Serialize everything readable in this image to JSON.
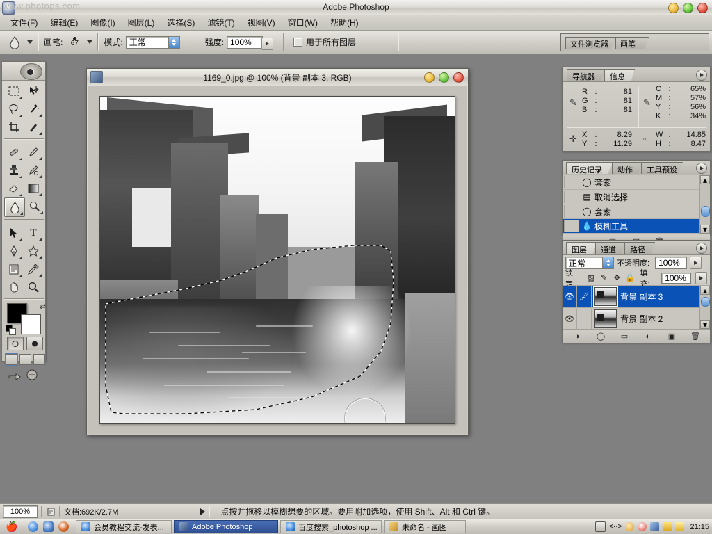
{
  "window": {
    "title": "Adobe Photoshop",
    "watermark": "www.photops.com",
    "buttons": {
      "minimize": "minimize",
      "maximize": "maximize",
      "close": "close"
    }
  },
  "menu": {
    "items": [
      {
        "label": "文件(F)"
      },
      {
        "label": "编辑(E)"
      },
      {
        "label": "图像(I)"
      },
      {
        "label": "图层(L)"
      },
      {
        "label": "选择(S)"
      },
      {
        "label": "滤镜(T)"
      },
      {
        "label": "视图(V)"
      },
      {
        "label": "窗口(W)"
      },
      {
        "label": "帮助(H)"
      }
    ]
  },
  "options_bar": {
    "tool_icon": "blur-droplet-icon",
    "brush_label": "画笔:",
    "brush_size": "67",
    "mode_label": "模式:",
    "mode_value": "正常",
    "strength_label": "强度:",
    "strength_value": "100%",
    "all_layers_label": "用于所有图层",
    "all_layers_checked": false,
    "palette_well_icon": "palette-well-icon"
  },
  "palette_well": {
    "tabs": [
      {
        "label": "文件浏览器"
      },
      {
        "label": "画笔"
      }
    ]
  },
  "toolbox": {
    "tools": [
      {
        "name": "marquee-tool",
        "glyph": "▭"
      },
      {
        "name": "move-tool",
        "glyph": "✥"
      },
      {
        "name": "lasso-tool",
        "glyph": "◯"
      },
      {
        "name": "magic-wand-tool",
        "glyph": "✳"
      },
      {
        "name": "crop-tool",
        "glyph": "⌗"
      },
      {
        "name": "slice-tool",
        "glyph": "✎"
      },
      {
        "name": "healing-brush-tool",
        "glyph": "✐"
      },
      {
        "name": "brush-tool",
        "glyph": "🖌"
      },
      {
        "name": "clone-stamp-tool",
        "glyph": "⎙"
      },
      {
        "name": "history-brush-tool",
        "glyph": "✑"
      },
      {
        "name": "eraser-tool",
        "glyph": "▱"
      },
      {
        "name": "gradient-tool",
        "glyph": "▤"
      },
      {
        "name": "blur-tool",
        "glyph": "💧",
        "selected": true
      },
      {
        "name": "dodge-tool",
        "glyph": "◐"
      },
      {
        "name": "path-selection-tool",
        "glyph": "➤"
      },
      {
        "name": "type-tool",
        "glyph": "T"
      },
      {
        "name": "pen-tool",
        "glyph": "✒"
      },
      {
        "name": "custom-shape-tool",
        "glyph": "✦"
      },
      {
        "name": "notes-tool",
        "glyph": "▤"
      },
      {
        "name": "eyedropper-tool",
        "glyph": "✎"
      },
      {
        "name": "hand-tool",
        "glyph": "✋"
      },
      {
        "name": "zoom-tool",
        "glyph": "🔍"
      }
    ],
    "foreground_color": "#000000",
    "background_color": "#ffffff",
    "quickmask": [
      {
        "name": "standard-mode",
        "active": true
      },
      {
        "name": "quick-mask-mode",
        "active": false
      }
    ],
    "screen_modes": [
      {
        "name": "standard-screen-mode",
        "active": true
      },
      {
        "name": "full-screen-menubar-mode",
        "active": false
      },
      {
        "name": "full-screen-mode",
        "active": false
      }
    ],
    "jump_to": "jump-to-imageready-icon"
  },
  "document": {
    "title": "1169_0.jpg @ 100% (背景 副本 3, RGB)",
    "filename": "1169_0.jpg",
    "zoom": "100%",
    "layer": "背景 副本 3",
    "color_mode": "RGB"
  },
  "info_palette": {
    "tabs": [
      {
        "label": "导航器",
        "active": false
      },
      {
        "label": "信息",
        "active": true
      }
    ],
    "rgb": [
      {
        "key": "R",
        "value": "81"
      },
      {
        "key": "G",
        "value": "81"
      },
      {
        "key": "B",
        "value": "81"
      }
    ],
    "cmyk": [
      {
        "key": "C",
        "value": "65%"
      },
      {
        "key": "M",
        "value": "57%"
      },
      {
        "key": "Y",
        "value": "56%"
      },
      {
        "key": "K",
        "value": "34%"
      }
    ],
    "position": [
      {
        "key": "X",
        "value": "8.29"
      },
      {
        "key": "Y",
        "value": "11.29"
      }
    ],
    "size": [
      {
        "key": "W",
        "value": "14.85"
      },
      {
        "key": "H",
        "value": "8.47"
      }
    ]
  },
  "history_palette": {
    "tabs": [
      {
        "label": "历史记录",
        "active": true
      },
      {
        "label": "动作",
        "active": false
      },
      {
        "label": "工具预设",
        "active": false
      }
    ],
    "items": [
      {
        "label": "套索",
        "icon": "lasso-icon",
        "selected": false
      },
      {
        "label": "取消选择",
        "icon": "deselect-icon",
        "selected": false
      },
      {
        "label": "套索",
        "icon": "lasso-icon",
        "selected": false
      },
      {
        "label": "模糊工具",
        "icon": "blur-droplet-icon",
        "selected": true
      }
    ],
    "buttons": [
      {
        "name": "create-document-from-state-button",
        "glyph": "▣"
      },
      {
        "name": "create-new-snapshot-button",
        "glyph": "▤"
      },
      {
        "name": "delete-state-button",
        "glyph": "🗑"
      }
    ]
  },
  "layers_palette": {
    "tabs": [
      {
        "label": "图层",
        "active": true
      },
      {
        "label": "通道",
        "active": false
      },
      {
        "label": "路径",
        "active": false
      }
    ],
    "blend_mode": "正常",
    "opacity_label": "不透明度:",
    "opacity_value": "100%",
    "lock_label": "锁定:",
    "lock_icons": [
      {
        "name": "lock-transparency-icon",
        "glyph": "▨"
      },
      {
        "name": "lock-image-icon",
        "glyph": "✎"
      },
      {
        "name": "lock-position-icon",
        "glyph": "✥"
      },
      {
        "name": "lock-all-icon",
        "glyph": "🔒"
      }
    ],
    "fill_label": "填充:",
    "fill_value": "100%",
    "layers": [
      {
        "name": "背景 副本 3",
        "visible": true,
        "selected": true,
        "has_brush_icon": true
      },
      {
        "name": "背景 副本 2",
        "visible": true,
        "selected": false,
        "has_brush_icon": false
      }
    ],
    "buttons": [
      {
        "name": "layer-style-button",
        "glyph": "◑"
      },
      {
        "name": "layer-mask-button",
        "glyph": "◯"
      },
      {
        "name": "new-group-button",
        "glyph": "▭"
      },
      {
        "name": "adjustment-layer-button",
        "glyph": "◐"
      },
      {
        "name": "new-layer-button",
        "glyph": "▣"
      },
      {
        "name": "delete-layer-button",
        "glyph": "🗑"
      }
    ]
  },
  "status_bar": {
    "zoom": "100%",
    "doc_icon": "document-size-icon",
    "doc_info": "文档:692K/2.7M",
    "hint": "点按并拖移以模糊想要的区域。要用附加选项，使用 Shift、Alt 和 Ctrl 键。"
  },
  "taskbar": {
    "start_label": "start-button",
    "quick_launch": [
      {
        "name": "ie-quicklaunch-icon"
      },
      {
        "name": "browser-quicklaunch-icon"
      },
      {
        "name": "media-player-quicklaunch-icon"
      }
    ],
    "tasks": [
      {
        "label": "会员教程交流-发表...",
        "active": false
      },
      {
        "label": "Adobe Photoshop",
        "active": true
      },
      {
        "label": "百度搜索_photoshop ...",
        "active": false
      },
      {
        "label": "未命名 - 画图",
        "active": false
      }
    ],
    "tray": [
      {
        "name": "keyboard-layout-icon"
      },
      {
        "name": "network-connection-icon"
      },
      {
        "name": "face-tray-icon"
      },
      {
        "name": "qq-penguin-icon"
      },
      {
        "name": "messenger-tray-icon"
      },
      {
        "name": "security-lock-icon"
      },
      {
        "name": "warning-tray-icon"
      }
    ],
    "clock": "21:15"
  },
  "colors": {
    "desktop": "#808080",
    "selection_blue": "#0a52b5",
    "panel_gray": "#c8c6bf"
  }
}
